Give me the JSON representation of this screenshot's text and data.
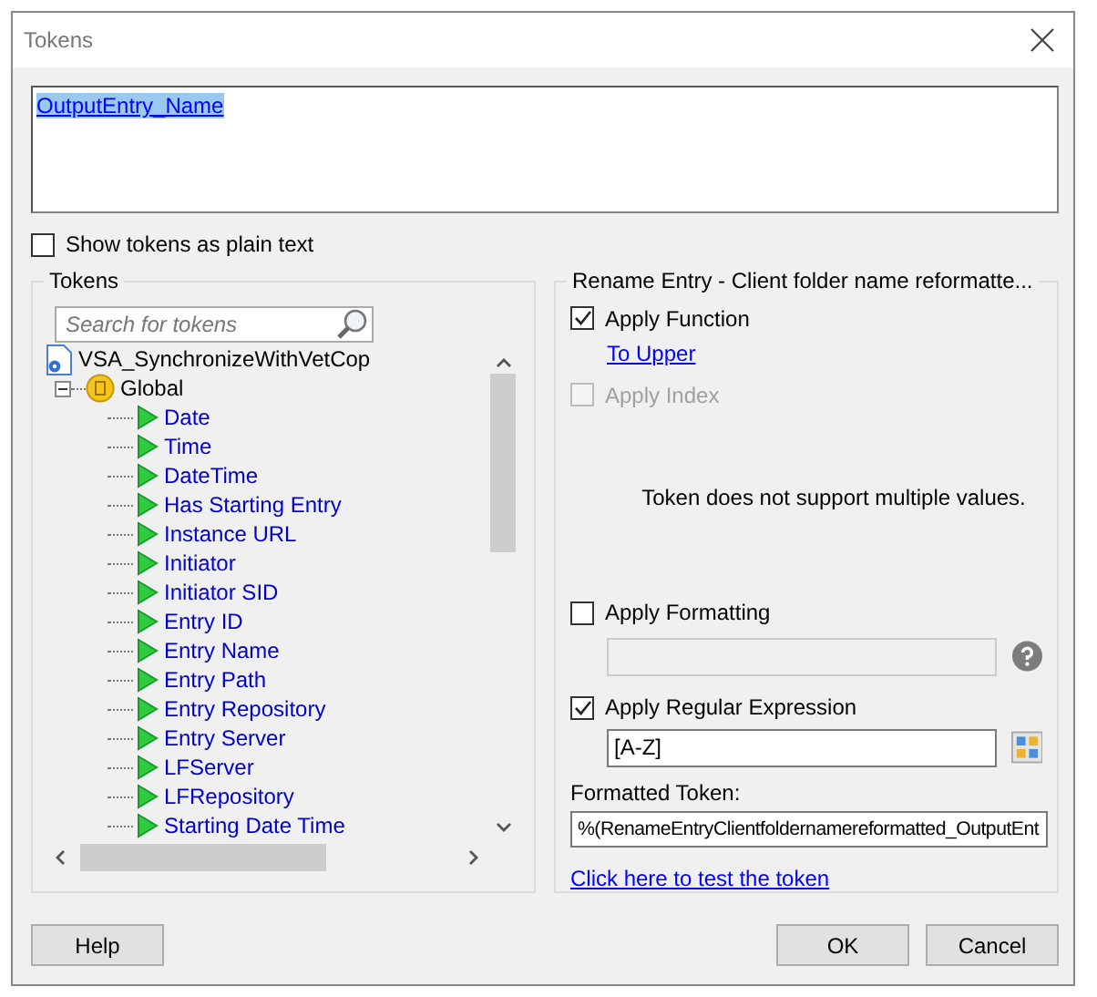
{
  "window": {
    "title": "Tokens"
  },
  "token_text": {
    "value": "OutputEntry_Name",
    "selected": true
  },
  "plain_text_option": {
    "label": "Show tokens as plain text",
    "checked": false
  },
  "tokens_panel": {
    "title": "Tokens",
    "search": {
      "placeholder": "Search for tokens"
    },
    "tree": [
      {
        "label": "VSA_SynchronizeWithVetCop",
        "kind": "workflow",
        "children": [
          {
            "label": "Global",
            "kind": "group",
            "expanded": true,
            "children": [
              {
                "label": "Date",
                "kind": "token"
              },
              {
                "label": "Time",
                "kind": "token"
              },
              {
                "label": "DateTime",
                "kind": "token"
              },
              {
                "label": "Has Starting Entry",
                "kind": "token"
              },
              {
                "label": "Instance URL",
                "kind": "token"
              },
              {
                "label": "Initiator",
                "kind": "token"
              },
              {
                "label": "Initiator SID",
                "kind": "token"
              },
              {
                "label": "Entry ID",
                "kind": "token"
              },
              {
                "label": "Entry Name",
                "kind": "token"
              },
              {
                "label": "Entry Path",
                "kind": "token"
              },
              {
                "label": "Entry Repository",
                "kind": "token"
              },
              {
                "label": "Entry Server",
                "kind": "token"
              },
              {
                "label": "LFServer",
                "kind": "token"
              },
              {
                "label": "LFRepository",
                "kind": "token"
              },
              {
                "label": "Starting Date Time",
                "kind": "token"
              }
            ]
          }
        ]
      }
    ]
  },
  "options_panel": {
    "title": "Rename Entry - Client folder name reformatte...",
    "apply_function": {
      "label": "Apply Function",
      "checked": true,
      "function_link": "To Upper"
    },
    "apply_index": {
      "label": "Apply Index",
      "checked": false,
      "disabled": true,
      "note": "Token does not support multiple values."
    },
    "apply_formatting": {
      "label": "Apply Formatting",
      "checked": false
    },
    "apply_regex": {
      "label": "Apply Regular Expression",
      "checked": true,
      "value": "[A-Z]"
    },
    "formatted_token": {
      "label": "Formatted Token:",
      "value": "%(RenameEntryClientfoldernamereformatted_OutputEnt"
    },
    "test_link": "Click here to test the token"
  },
  "buttons": {
    "help": "Help",
    "ok": "OK",
    "cancel": "Cancel"
  }
}
